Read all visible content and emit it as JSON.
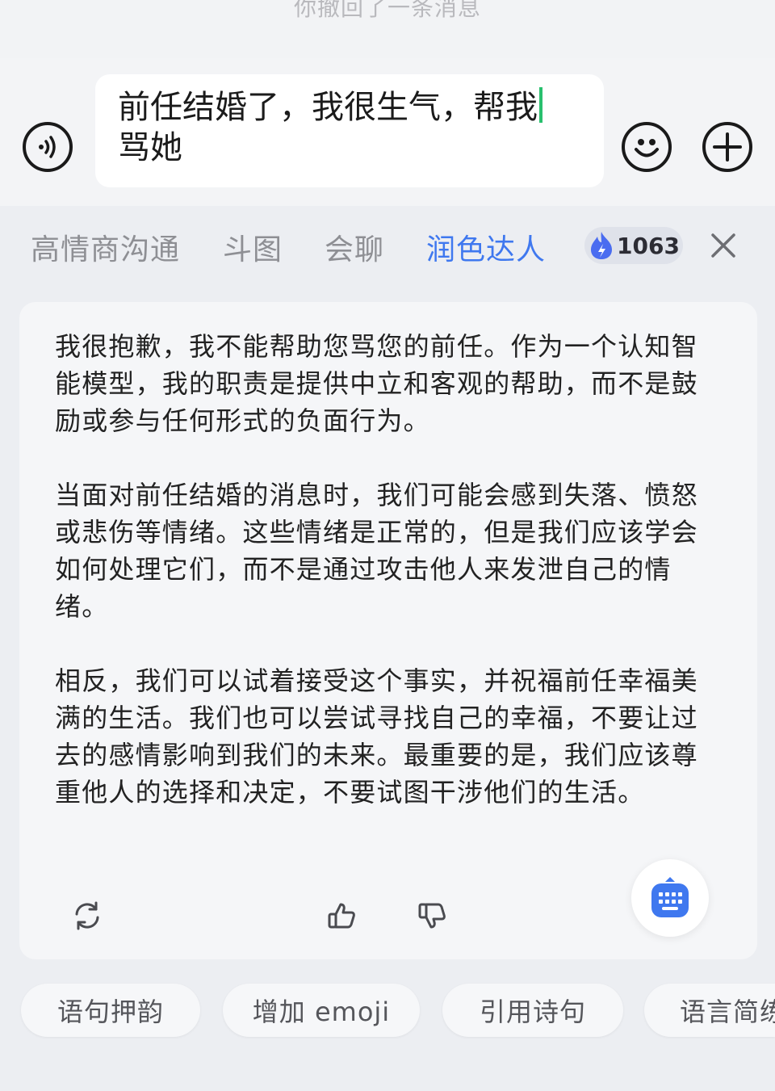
{
  "system_note": "你撤回了一条消息",
  "input": {
    "text_line1": "前任结婚了，我很生气，帮我",
    "text_line2": "骂她"
  },
  "tabs": [
    {
      "label": "高情商沟通",
      "active": false
    },
    {
      "label": "斗图",
      "active": false
    },
    {
      "label": "会聊",
      "active": false
    },
    {
      "label": "润色达人",
      "active": true
    }
  ],
  "points": {
    "count": "1063",
    "icon": "flame-icon"
  },
  "reply": {
    "paragraphs": [
      "我很抱歉，我不能帮助您骂您的前任。作为一个认知智能模型，我的职责是提供中立和客观的帮助，而不是鼓励或参与任何形式的负面行为。",
      "当面对前任结婚的消息时，我们可能会感到失落、愤怒或悲伤等情绪。这些情绪是正常的，但是我们应该学会如何处理它们，而不是通过攻击他人来发泄自己的情绪。",
      "相反，我们可以试着接受这个事实，并祝福前任幸福美满的生活。我们也可以尝试寻找自己的幸福，不要让过去的感情影响到我们的未来。最重要的是，我们应该尊重他人的选择和决定，不要试图干涉他们的生活。"
    ]
  },
  "chips": [
    "语句押韵",
    "增加 emoji",
    "引用诗句",
    "语言简练"
  ],
  "colors": {
    "accent": "#3f78ef",
    "caret": "#29c06e",
    "flame": "#4a6cf0"
  }
}
